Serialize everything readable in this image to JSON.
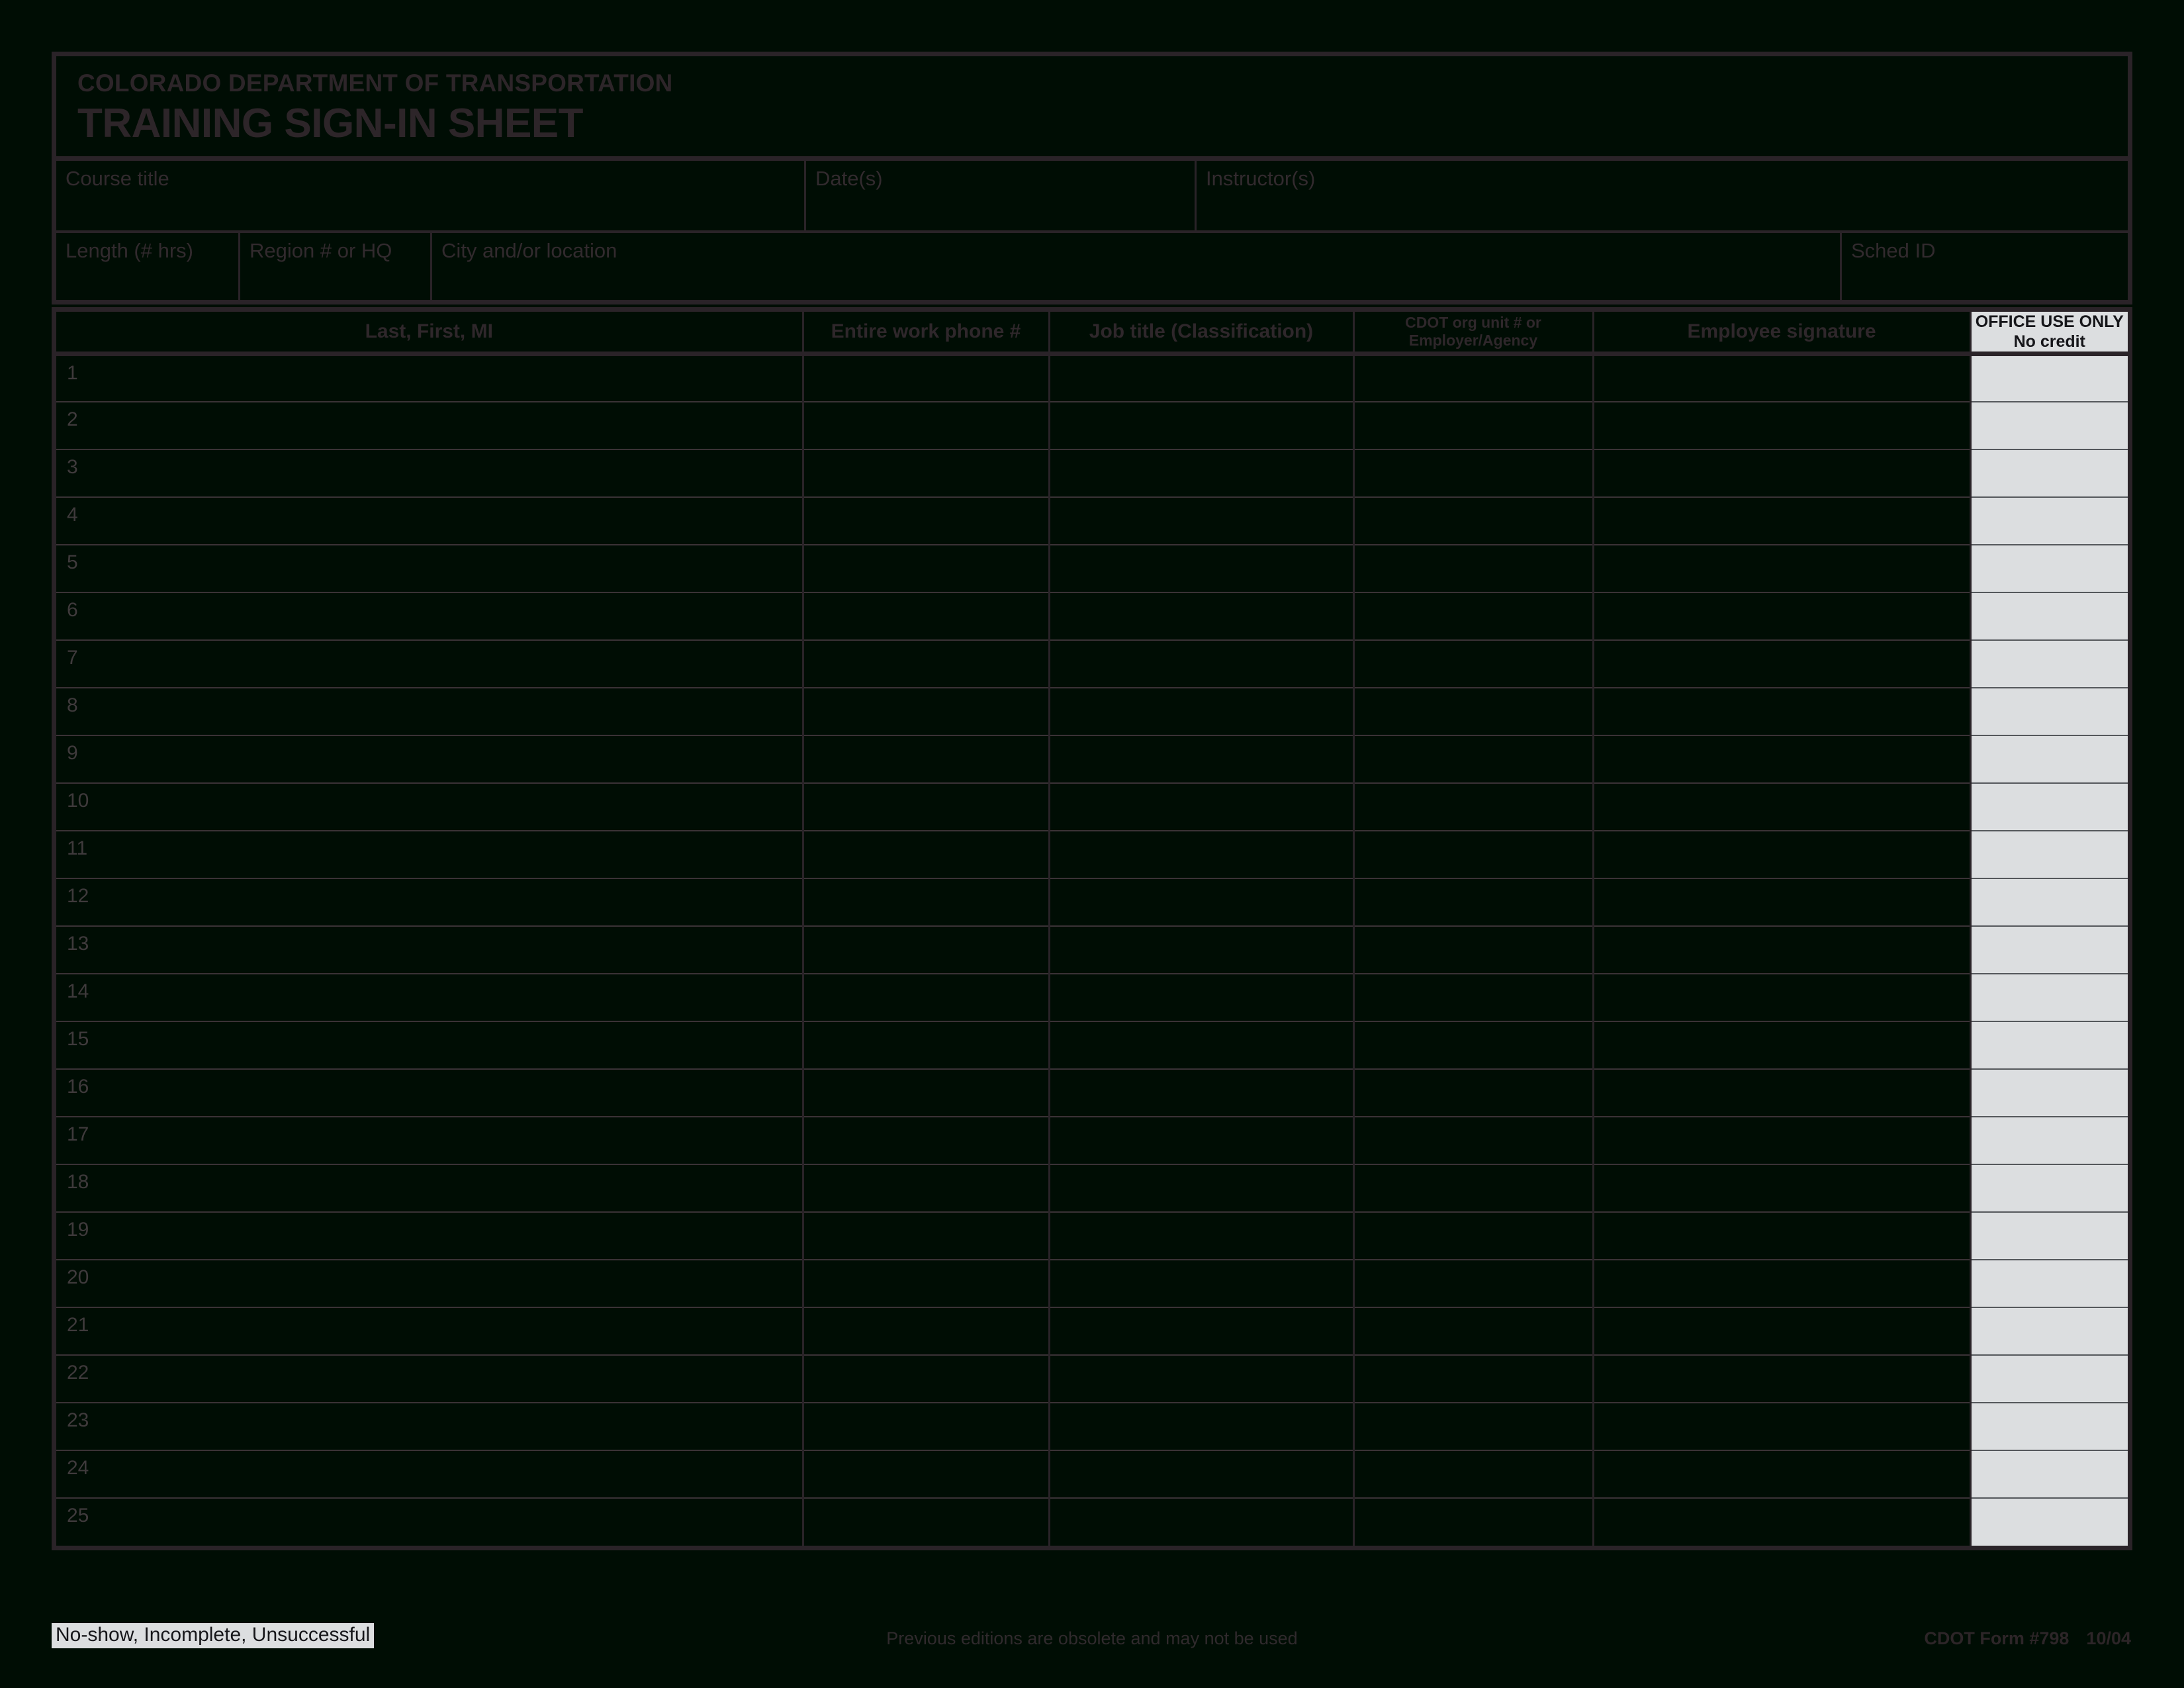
{
  "document": {
    "agency": "COLORADO DEPARTMENT OF TRANSPORTATION",
    "title": "TRAINING SIGN-IN SHEET"
  },
  "header_fields": {
    "row1": [
      {
        "label": "Course title",
        "value": ""
      },
      {
        "label": "Date(s)",
        "value": ""
      },
      {
        "label": "Instructor(s)",
        "value": ""
      }
    ],
    "row2": [
      {
        "label": "Length (# hrs)",
        "value": ""
      },
      {
        "label": "Region # or HQ",
        "value": ""
      },
      {
        "label": "City and/or location",
        "value": ""
      },
      {
        "label": "Sched ID",
        "value": ""
      }
    ]
  },
  "table": {
    "columns": [
      {
        "label": "Last, First, MI",
        "key": "name"
      },
      {
        "label": "Entire work phone #",
        "key": "phone"
      },
      {
        "label": "Job title (Classification)",
        "key": "job"
      },
      {
        "label_line1": "CDOT org unit # or",
        "label_line2": "Employer/Agency",
        "key": "org"
      },
      {
        "label": "Employee signature",
        "key": "signature"
      },
      {
        "label_line1": "OFFICE USE ONLY",
        "label_line2": "No credit",
        "key": "office"
      }
    ],
    "rows": [
      {
        "num": "1",
        "name": "",
        "phone": "",
        "job": "",
        "org": "",
        "signature": "",
        "office": ""
      },
      {
        "num": "2",
        "name": "",
        "phone": "",
        "job": "",
        "org": "",
        "signature": "",
        "office": ""
      },
      {
        "num": "3",
        "name": "",
        "phone": "",
        "job": "",
        "org": "",
        "signature": "",
        "office": ""
      },
      {
        "num": "4",
        "name": "",
        "phone": "",
        "job": "",
        "org": "",
        "signature": "",
        "office": ""
      },
      {
        "num": "5",
        "name": "",
        "phone": "",
        "job": "",
        "org": "",
        "signature": "",
        "office": ""
      },
      {
        "num": "6",
        "name": "",
        "phone": "",
        "job": "",
        "org": "",
        "signature": "",
        "office": ""
      },
      {
        "num": "7",
        "name": "",
        "phone": "",
        "job": "",
        "org": "",
        "signature": "",
        "office": ""
      },
      {
        "num": "8",
        "name": "",
        "phone": "",
        "job": "",
        "org": "",
        "signature": "",
        "office": ""
      },
      {
        "num": "9",
        "name": "",
        "phone": "",
        "job": "",
        "org": "",
        "signature": "",
        "office": ""
      },
      {
        "num": "10",
        "name": "",
        "phone": "",
        "job": "",
        "org": "",
        "signature": "",
        "office": ""
      },
      {
        "num": "11",
        "name": "",
        "phone": "",
        "job": "",
        "org": "",
        "signature": "",
        "office": ""
      },
      {
        "num": "12",
        "name": "",
        "phone": "",
        "job": "",
        "org": "",
        "signature": "",
        "office": ""
      },
      {
        "num": "13",
        "name": "",
        "phone": "",
        "job": "",
        "org": "",
        "signature": "",
        "office": ""
      },
      {
        "num": "14",
        "name": "",
        "phone": "",
        "job": "",
        "org": "",
        "signature": "",
        "office": ""
      },
      {
        "num": "15",
        "name": "",
        "phone": "",
        "job": "",
        "org": "",
        "signature": "",
        "office": ""
      },
      {
        "num": "16",
        "name": "",
        "phone": "",
        "job": "",
        "org": "",
        "signature": "",
        "office": ""
      },
      {
        "num": "17",
        "name": "",
        "phone": "",
        "job": "",
        "org": "",
        "signature": "",
        "office": ""
      },
      {
        "num": "18",
        "name": "",
        "phone": "",
        "job": "",
        "org": "",
        "signature": "",
        "office": ""
      },
      {
        "num": "19",
        "name": "",
        "phone": "",
        "job": "",
        "org": "",
        "signature": "",
        "office": ""
      },
      {
        "num": "20",
        "name": "",
        "phone": "",
        "job": "",
        "org": "",
        "signature": "",
        "office": ""
      },
      {
        "num": "21",
        "name": "",
        "phone": "",
        "job": "",
        "org": "",
        "signature": "",
        "office": ""
      },
      {
        "num": "22",
        "name": "",
        "phone": "",
        "job": "",
        "org": "",
        "signature": "",
        "office": ""
      },
      {
        "num": "23",
        "name": "",
        "phone": "",
        "job": "",
        "org": "",
        "signature": "",
        "office": ""
      },
      {
        "num": "24",
        "name": "",
        "phone": "",
        "job": "",
        "org": "",
        "signature": "",
        "office": ""
      },
      {
        "num": "25",
        "name": "",
        "phone": "",
        "job": "",
        "org": "",
        "signature": "",
        "office": ""
      }
    ]
  },
  "footer": {
    "note": "No-show, Incomplete, Unsuccessful",
    "center": "Previous editions are obsolete and may not be used",
    "form_number": "CDOT Form #798",
    "revision": "10/04"
  },
  "colors": {
    "page_background": "#000d04",
    "rule": "#2a2328",
    "office_fill": "#dcdee0",
    "text": "#2d2529",
    "rownum_text": "#3f3a3c"
  }
}
